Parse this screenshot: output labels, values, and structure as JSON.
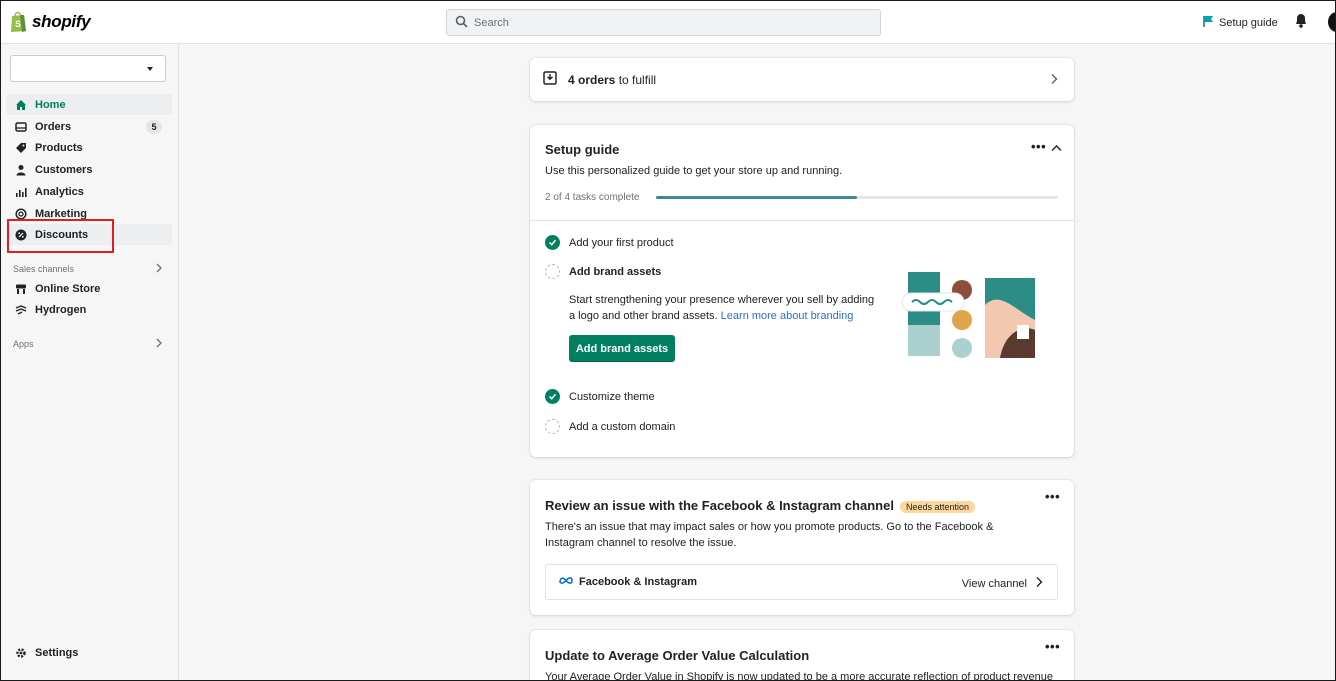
{
  "topbar": {
    "logo_text": "shopify",
    "search_placeholder": "Search",
    "setup_guide_label": "Setup guide"
  },
  "sidebar": {
    "store_select_value": "",
    "items": [
      {
        "label": "Home"
      },
      {
        "label": "Orders",
        "count": "5"
      },
      {
        "label": "Products"
      },
      {
        "label": "Customers"
      },
      {
        "label": "Analytics"
      },
      {
        "label": "Marketing"
      },
      {
        "label": "Discounts"
      }
    ],
    "sales_channels_label": "Sales channels",
    "channels": [
      {
        "label": "Online Store"
      },
      {
        "label": "Hydrogen"
      }
    ],
    "apps_label": "Apps",
    "settings_label": "Settings"
  },
  "orders_card": {
    "count_text": "4 orders",
    "suffix_text": "to fulfill"
  },
  "setup_card": {
    "title": "Setup guide",
    "description": "Use this personalized guide to get your store up and running.",
    "progress_text": "2 of 4 tasks complete",
    "progress_fraction": 0.5,
    "tasks": [
      {
        "label": "Add your first product",
        "done": true
      },
      {
        "label": "Add brand assets",
        "done": false
      },
      {
        "label": "Customize theme",
        "done": true
      },
      {
        "label": "Add a custom domain",
        "done": false
      }
    ],
    "brand_text": "Start strengthening your presence wherever you sell by adding a logo and other brand assets.",
    "brand_link": "Learn more about branding",
    "brand_button": "Add brand assets"
  },
  "fb_card": {
    "title": "Review an issue with the Facebook & Instagram channel",
    "badge": "Needs attention",
    "description": "There's an issue that may impact sales or how you promote products. Go to the Facebook & Instagram channel to resolve the issue.",
    "channel_name": "Facebook & Instagram",
    "view_channel": "View channel"
  },
  "aov_card": {
    "title": "Update to Average Order Value Calculation",
    "description": "Your Average Order Value in Shopify is now updated to be a more accurate reflection of product revenue"
  },
  "colors": {
    "accent_green": "#008060",
    "progress_teal": "#3d8a8e",
    "badge_warning": "#ffd79d",
    "highlight_red": "#e02020"
  }
}
